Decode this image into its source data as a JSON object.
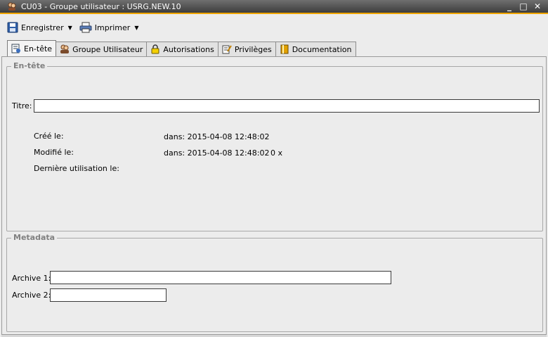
{
  "window": {
    "title": "CU03 - Groupe utilisateur : USRG.NEW.10"
  },
  "toolbar": {
    "save_label": "Enregistrer",
    "print_label": "Imprimer"
  },
  "tabs": [
    {
      "label": "En-tête",
      "icon": "header-doc-icon",
      "active": true
    },
    {
      "label": "Groupe Utilisateur",
      "icon": "users-icon"
    },
    {
      "label": "Autorisations",
      "icon": "lock-icon"
    },
    {
      "label": "Privilèges",
      "icon": "privileges-icon"
    },
    {
      "label": "Documentation",
      "icon": "book-icon"
    }
  ],
  "header_group": {
    "title": "En-tête",
    "titre_label": "Titre:",
    "titre_value": "",
    "created_label": "Créé le:",
    "created_value": "dans: 2015-04-08 12:48:02",
    "modified_label": "Modifié le:",
    "modified_value": "dans: 2015-04-08 12:48:02",
    "modified_count": "0 x",
    "last_used_label": "Dernière utilisation le:"
  },
  "metadata_group": {
    "title": "Metadata",
    "archive1_label": "Archive 1:",
    "archive1_value": "",
    "archive2_label": "Archive 2:",
    "archive2_value": ""
  },
  "colors": {
    "accent": "#f0a500",
    "titlebar": "#4a4a4a"
  }
}
